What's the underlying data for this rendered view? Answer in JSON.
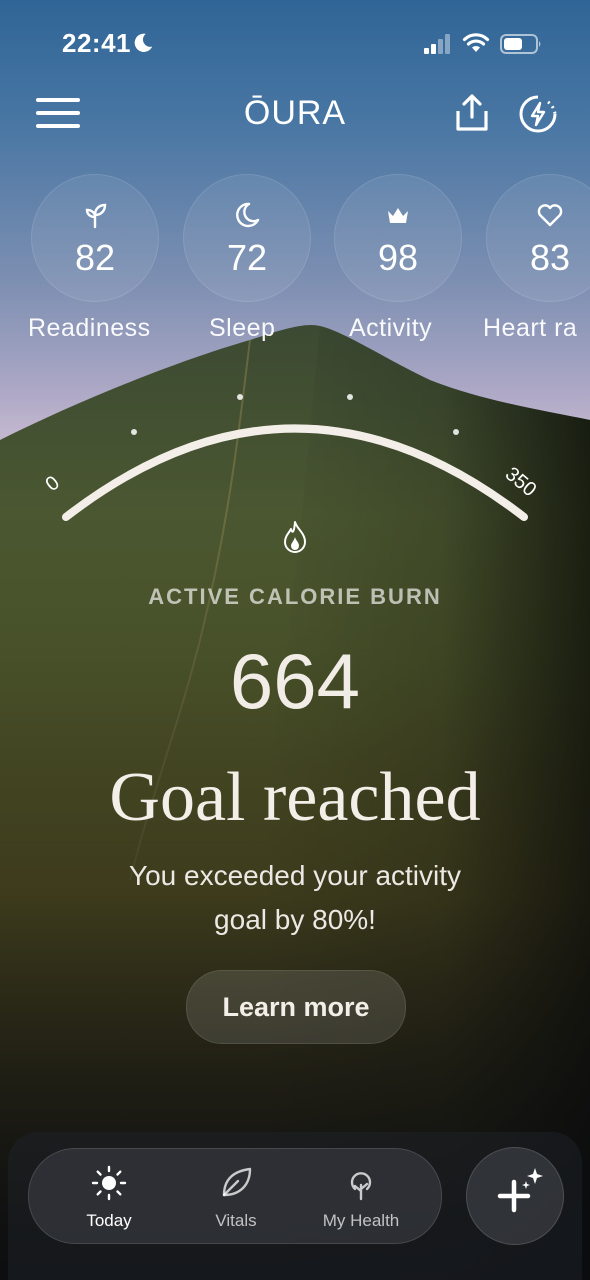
{
  "status_bar": {
    "time": "22:41"
  },
  "header": {
    "logo": "ŌURA"
  },
  "scores": [
    {
      "icon": "sprout-icon",
      "value": "82",
      "label": "Readiness"
    },
    {
      "icon": "moon-icon",
      "value": "72",
      "label": "Sleep"
    },
    {
      "icon": "crown-icon",
      "value": "98",
      "label": "Activity"
    },
    {
      "icon": "heart-icon",
      "value": "83",
      "label": "Heart ra"
    }
  ],
  "gauge": {
    "min_label": "0",
    "max_label": "350",
    "value": 664,
    "goal": 350
  },
  "activity": {
    "title": "ACTIVE CALORIE BURN",
    "value": "664",
    "headline": "Goal reached",
    "description_line1": "You exceeded your activity",
    "description_line2": "goal by 80%!",
    "button": "Learn more"
  },
  "tabs": [
    {
      "icon": "sun-icon",
      "label": "Today",
      "active": true
    },
    {
      "icon": "leaf-icon",
      "label": "Vitals",
      "active": false
    },
    {
      "icon": "tree-icon",
      "label": "My Health",
      "active": false
    }
  ],
  "colors": {
    "accent": "#f4eee8",
    "sky": "#2f6596"
  }
}
